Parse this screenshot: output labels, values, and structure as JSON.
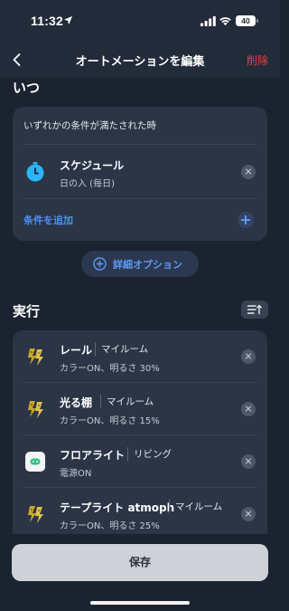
{
  "status_bar": {
    "time": "11:32",
    "battery": "40"
  },
  "nav": {
    "title": "オートメーションを編集",
    "delete_label": "削除"
  },
  "when_section": {
    "title": "いつ",
    "condition_mode": "いずれかの条件が満たされた時",
    "conditions": [
      {
        "title": "スケジュール",
        "subtitle": "日の入 (毎日)",
        "icon": "clock-icon"
      }
    ],
    "add_condition_label": "条件を追加"
  },
  "advanced_options_label": "詳細オプション",
  "exec_section": {
    "title": "実行",
    "actions": [
      {
        "name": "レール",
        "room": "マイルーム",
        "state": "カラーON、明るさ 30%",
        "icon": "led-strip-icon"
      },
      {
        "name": "光る棚",
        "room": "マイルーム",
        "state": "カラーON、明るさ 15%",
        "icon": "led-strip-icon"
      },
      {
        "name": "フロアライト",
        "room": "リビング",
        "state": "電源ON",
        "icon": "smart-plug-icon"
      },
      {
        "name": "テープライト atmoph",
        "room": "マイルーム",
        "state": "カラーON、明るさ 25%",
        "icon": "led-strip-icon"
      }
    ]
  },
  "save_label": "保存",
  "colors": {
    "background": "#1b2331",
    "card": "#2b3546",
    "accent_blue": "#4b8ff5",
    "delete_red": "#e4463d",
    "save_button": "#ced1d6"
  }
}
